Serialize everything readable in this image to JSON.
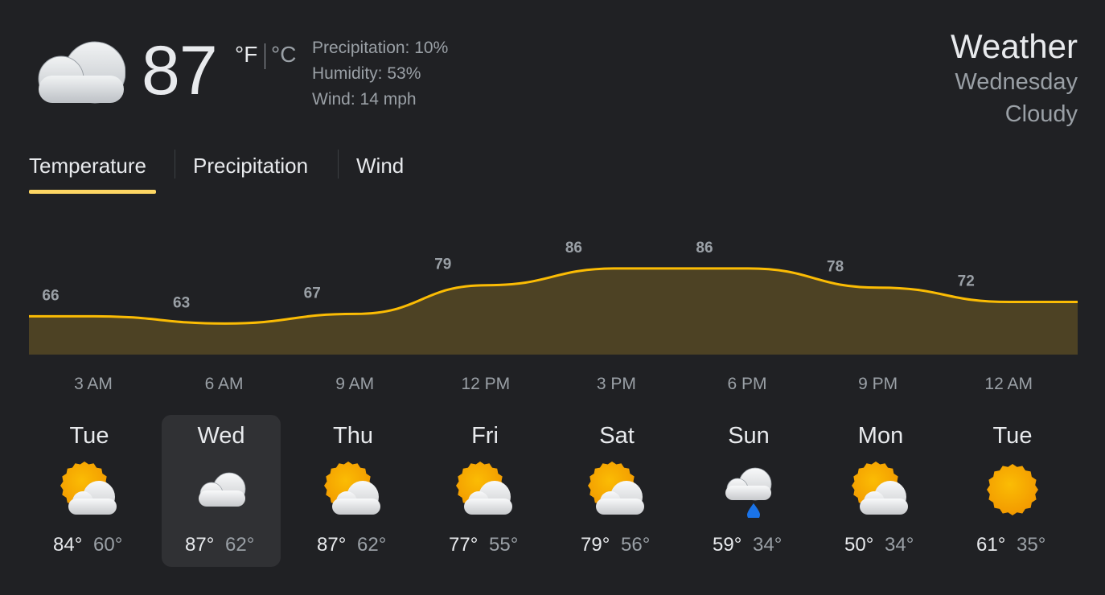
{
  "current": {
    "icon": "cloudy-icon",
    "temperature": "87",
    "unit_f": "°F",
    "unit_c": "°C",
    "precipitation": "Precipitation: 10%",
    "humidity": "Humidity: 53%",
    "wind": "Wind: 14 mph"
  },
  "header": {
    "title": "Weather",
    "day": "Wednesday",
    "condition": "Cloudy"
  },
  "tabs": [
    {
      "label": "Temperature",
      "active": true
    },
    {
      "label": "Precipitation",
      "active": false
    },
    {
      "label": "Wind",
      "active": false
    }
  ],
  "colors": {
    "accent": "#fdd663",
    "line": "#fbbc04",
    "area": "#4d4224",
    "background": "#202124",
    "selected": "#303134"
  },
  "chart_data": {
    "type": "area",
    "x": [
      "3 AM",
      "6 AM",
      "9 AM",
      "12 PM",
      "3 PM",
      "6 PM",
      "9 PM",
      "12 AM"
    ],
    "values": [
      66,
      63,
      67,
      79,
      86,
      86,
      78,
      72
    ]
  },
  "days": [
    {
      "name": "Tue",
      "icon": "partly-cloudy-icon",
      "high": "84°",
      "low": "60°",
      "selected": false
    },
    {
      "name": "Wed",
      "icon": "cloudy-icon",
      "high": "87°",
      "low": "62°",
      "selected": true
    },
    {
      "name": "Thu",
      "icon": "partly-cloudy-icon",
      "high": "87°",
      "low": "62°",
      "selected": false
    },
    {
      "name": "Fri",
      "icon": "partly-cloudy-icon",
      "high": "77°",
      "low": "55°",
      "selected": false
    },
    {
      "name": "Sat",
      "icon": "partly-cloudy-icon",
      "high": "79°",
      "low": "56°",
      "selected": false
    },
    {
      "name": "Sun",
      "icon": "rain-icon",
      "high": "59°",
      "low": "34°",
      "selected": false
    },
    {
      "name": "Mon",
      "icon": "partly-cloudy-icon",
      "high": "50°",
      "low": "34°",
      "selected": false
    },
    {
      "name": "Tue",
      "icon": "sunny-icon",
      "high": "61°",
      "low": "35°",
      "selected": false
    }
  ]
}
